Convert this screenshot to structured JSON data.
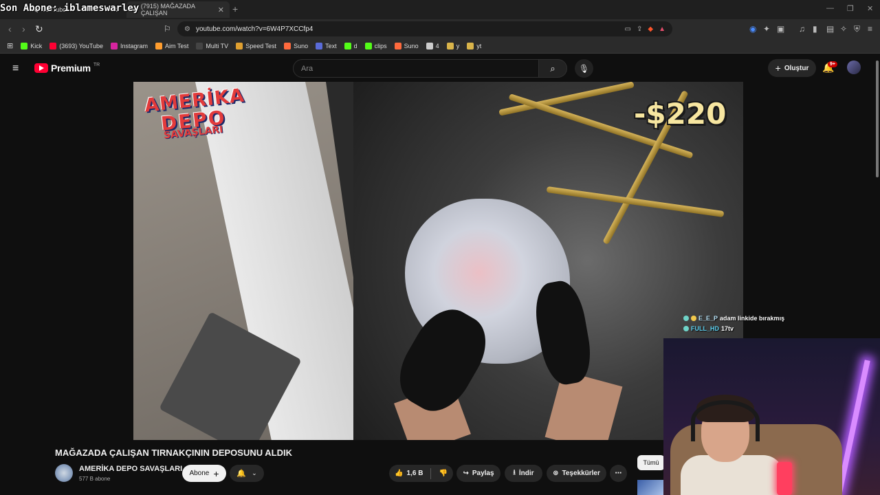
{
  "overlay": {
    "last_subscriber": "Son Abone: iblameswarley"
  },
  "browser": {
    "tabs": [
      {
        "label": "YouTube",
        "active": false
      },
      {
        "label": "(7915) MAĞAZADA ÇALIŞAN",
        "active": true
      }
    ],
    "url": "youtube.com/watch?v=6W4P7XCCfp4",
    "bookmarks": [
      {
        "label": "Kick",
        "color": "#53fc18"
      },
      {
        "label": "(3693) YouTube",
        "color": "#ff0033"
      },
      {
        "label": "Instagram",
        "color": "#d6249f"
      },
      {
        "label": "Aim Test",
        "color": "#ff9d2e"
      },
      {
        "label": "Multi TV",
        "color": "#444444"
      },
      {
        "label": "Speed Test",
        "color": "#e0a030"
      },
      {
        "label": "Suno",
        "color": "#ff6a3d"
      },
      {
        "label": "Text",
        "color": "#5a6bd8"
      },
      {
        "label": "d",
        "color": "#53fc18"
      },
      {
        "label": "clips",
        "color": "#53fc18"
      },
      {
        "label": "Suno",
        "color": "#ff6a3d"
      },
      {
        "label": "4",
        "color": "#cccccc"
      },
      {
        "label": "y",
        "color": "#d9b44a"
      },
      {
        "label": "yt",
        "color": "#d9b44a"
      }
    ]
  },
  "youtube": {
    "logo_text": "Premium",
    "logo_region": "TR",
    "search_placeholder": "Ara",
    "create_label": "Oluştur",
    "notification_count": "9+",
    "video": {
      "watermark_line1": "AMERİKA",
      "watermark_line2": "DEPO",
      "watermark_line3": "SAVAŞLARI",
      "price_overlay": "-$220"
    },
    "title": "MAĞAZADA ÇALIŞAN TIRNAKÇININ DEPOSUNU ALDIK",
    "channel": {
      "name": "AMERİKA DEPO SAVAŞLARI",
      "subscribers": "577 B abone",
      "subscribe_label": "Abone"
    },
    "actions": {
      "likes": "1,6 B",
      "share": "Paylaş",
      "download": "İndir",
      "thanks": "Teşekkürler"
    },
    "sidebar_chip": "Tümü"
  },
  "chat": [
    {
      "user": "E_E_P",
      "message": "adam linkide bırakmış"
    },
    {
      "user": "FULL_HD",
      "message": "17tv"
    }
  ]
}
